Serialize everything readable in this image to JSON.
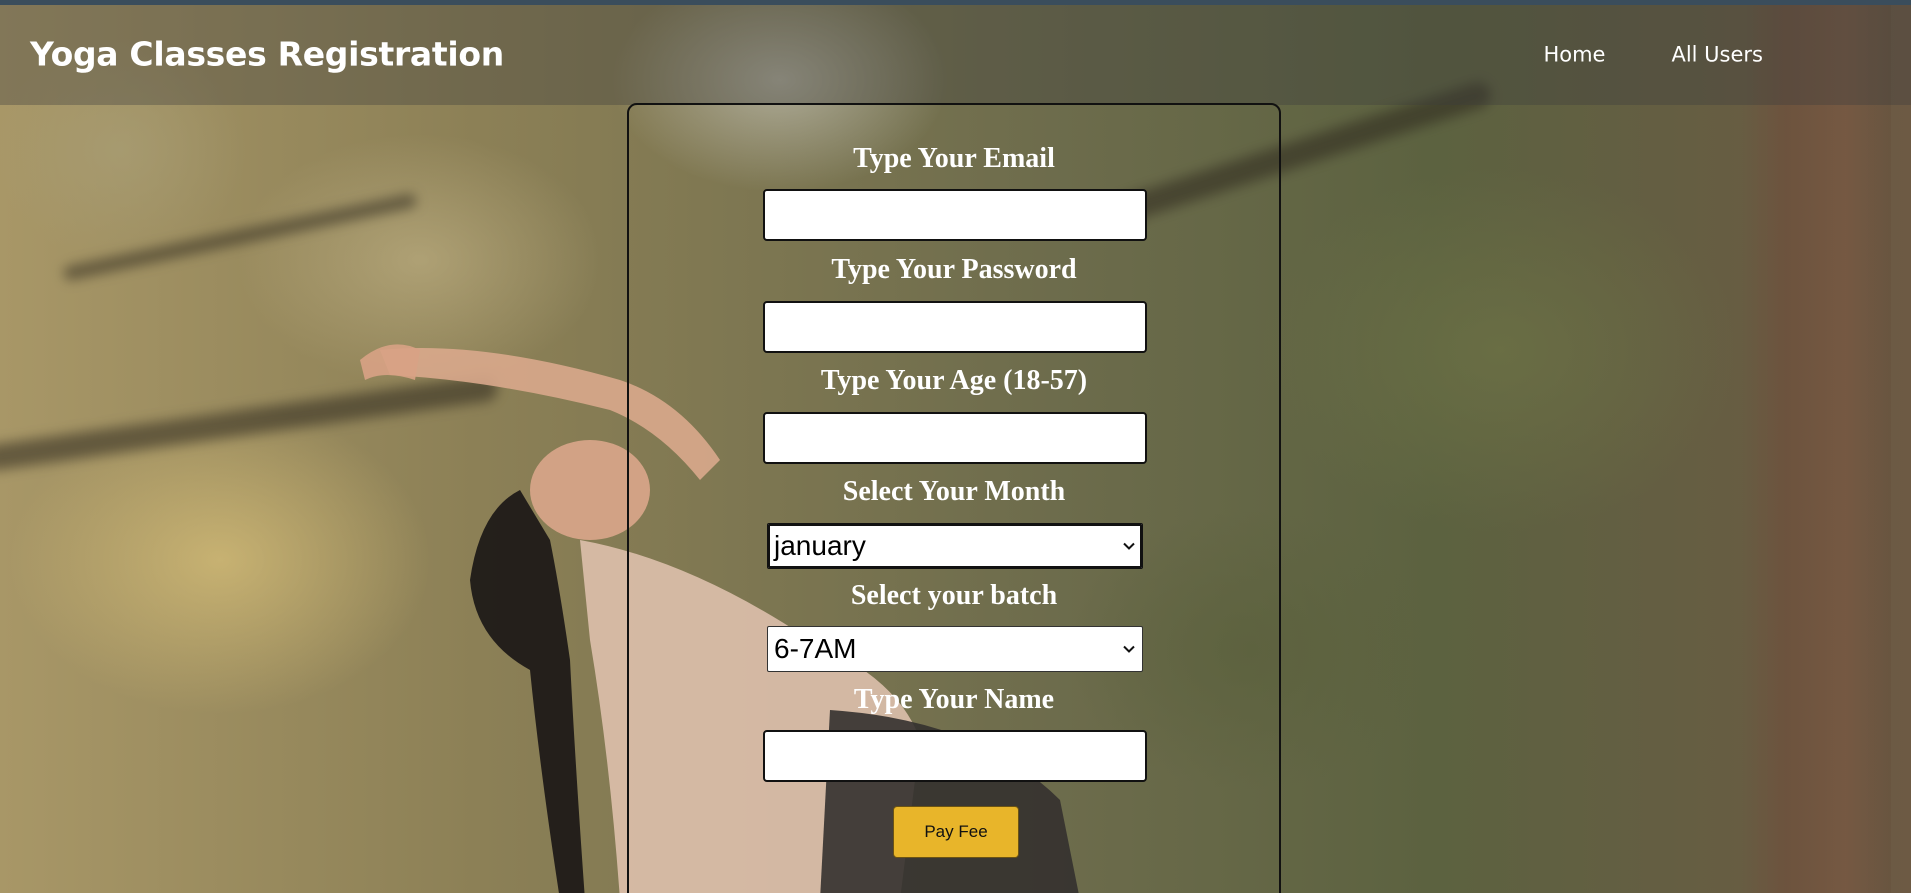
{
  "header": {
    "brand": "Yoga Classes Registration",
    "nav": [
      {
        "label": "Home"
      },
      {
        "label": "All Users"
      }
    ]
  },
  "form": {
    "email_label": "Type Your Email",
    "email_value": "",
    "password_label": "Type Your Password",
    "password_value": "",
    "age_label": "Type Your Age (18-57)",
    "age_value": "",
    "month_label": "Select Your Month",
    "month_selected": "january",
    "batch_label": "Select your batch",
    "batch_selected": "6-7AM",
    "name_label": "Type Your Name",
    "name_value": "",
    "submit_label": "Pay Fee"
  },
  "colors": {
    "button_bg": "#e8b52a",
    "text": "#ffffff",
    "panel_border": "#111111"
  },
  "icons": {
    "select_arrow": "chevron-down-icon"
  }
}
